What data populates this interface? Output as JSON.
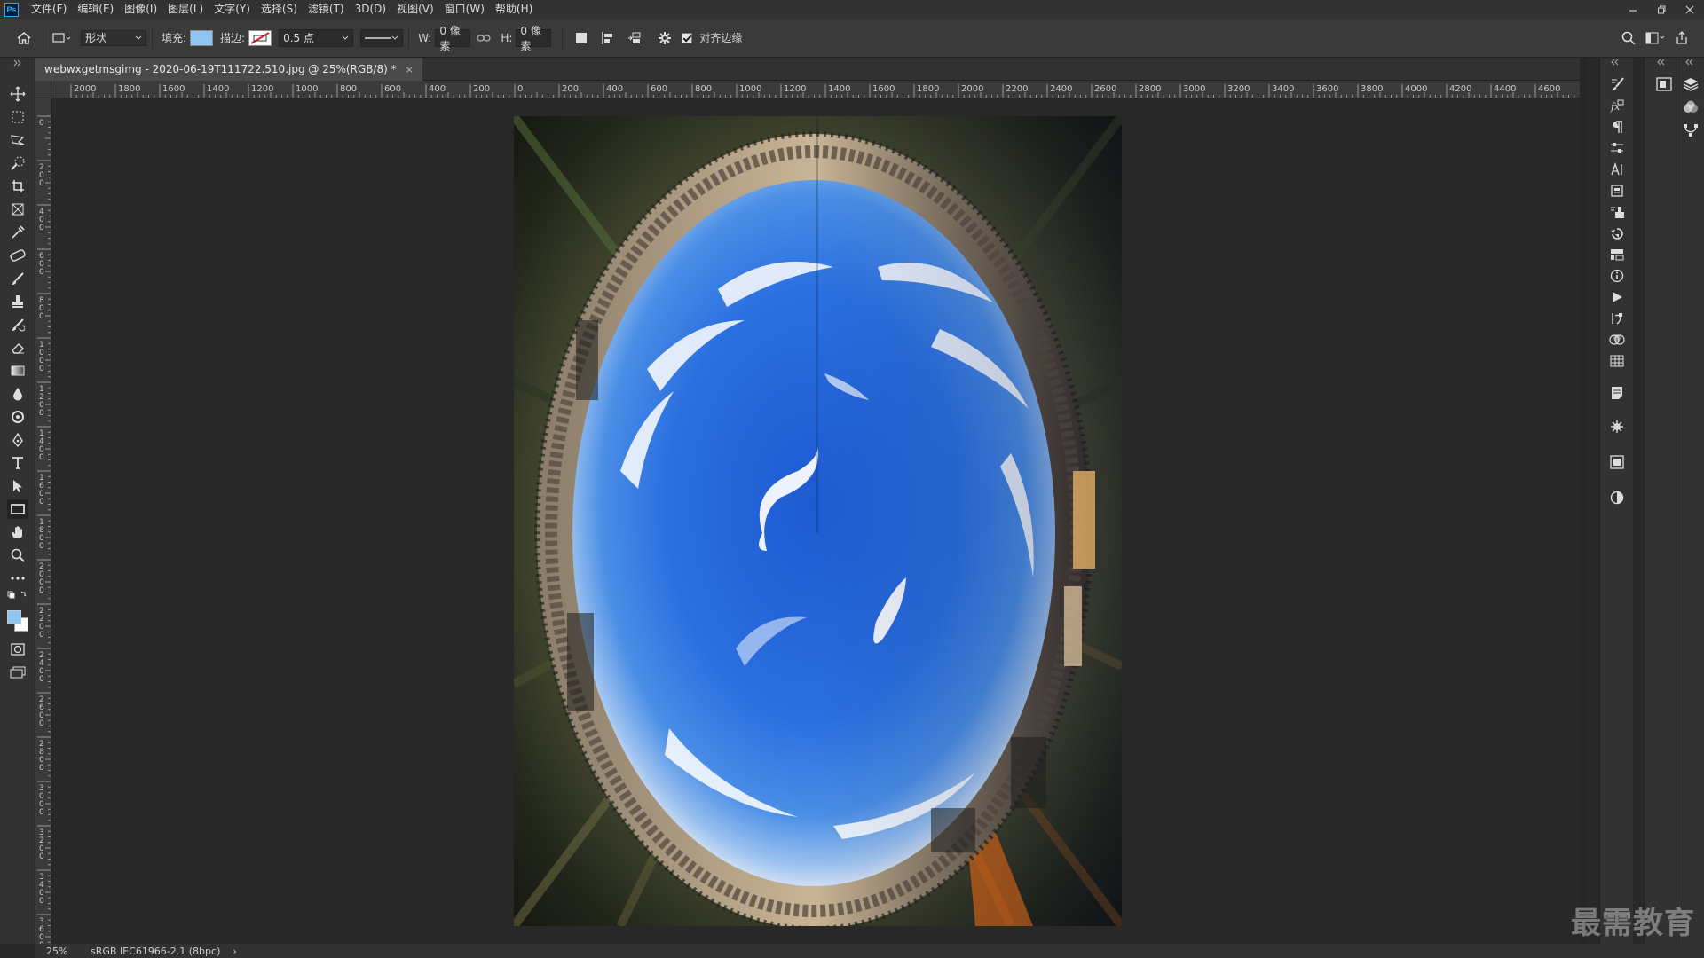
{
  "app": {
    "logo": "Ps"
  },
  "menu": [
    "文件(F)",
    "编辑(E)",
    "图像(I)",
    "图层(L)",
    "文字(Y)",
    "选择(S)",
    "滤镜(T)",
    "3D(D)",
    "视图(V)",
    "窗口(W)",
    "帮助(H)"
  ],
  "options": {
    "mode": "形状",
    "fill_label": "填充:",
    "fill_color": "#8ec5f5",
    "stroke_label": "描边:",
    "stroke_width": "0.5 点",
    "w_label": "W:",
    "w_value": "0 像素",
    "h_label": "H:",
    "h_value": "0 像素",
    "align_edges_label": "对齐边缘"
  },
  "document": {
    "tab_title": "webwxgetmsgimg - 2020-06-19T111722.510.jpg @ 25%(RGB/8) *",
    "close": "×"
  },
  "ruler_top_labels": [
    "2000",
    "1800",
    "1600",
    "1400",
    "1200",
    "1000",
    "800",
    "600",
    "400",
    "200",
    "0",
    "200",
    "400",
    "600",
    "800",
    "1000",
    "1200",
    "1400",
    "1600",
    "1800",
    "2000",
    "2200",
    "2400",
    "2600",
    "2800",
    "3000",
    "3200",
    "3400",
    "3600",
    "3800",
    "4000",
    "4200",
    "4400",
    "4600"
  ],
  "ruler_left_labels": [
    "0",
    "2 0 0",
    "4 0 0",
    "6 0 0",
    "8 0 0",
    "1 0 0 0",
    "1 2 0 0",
    "1 4 0 0",
    "1 6 0 0",
    "1 8 0 0",
    "2 0 0 0",
    "2 2 0 0",
    "2 4 0 0",
    "2 6 0 0",
    "2 8 0 0",
    "3 0 0 0",
    "3 2 0 0",
    "3 4 0 0",
    "3 6 0 0"
  ],
  "status": {
    "zoom": "25%",
    "profile": "sRGB IEC61966-2.1 (8bpc)",
    "arrow": "›"
  },
  "colors": {
    "foreground": "#8ec5f5",
    "background": "#ffffff"
  },
  "watermark": "最需教育"
}
